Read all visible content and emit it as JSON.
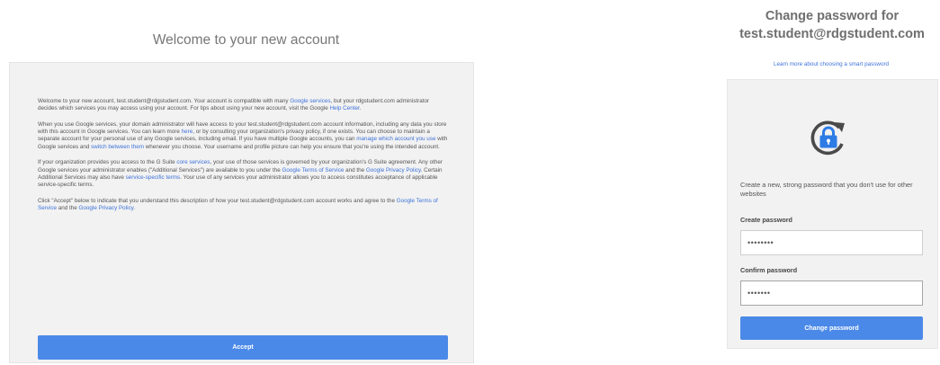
{
  "welcome": {
    "title": "Welcome to your new account",
    "p1": {
      "t1": "Welcome to your new account, test.student@rdgstudent.com. Your account is compatible with many ",
      "l1": "Google services",
      "t2": ", but your rdgstudent.com administrator decides which services you may access using your account. For tips about using your new account, visit the Google ",
      "l2": "Help Center",
      "t3": "."
    },
    "p2": {
      "t1": "When you use Google services, your domain administrator will have access to your test.student@rdgstudent.com account information, including any data you store with this account in Google services. You can learn more ",
      "l1": "here",
      "t2": ", or by consulting your organization's privacy policy, if one exists. You can choose to maintain a separate account for your personal use of any Google services, including email. If you have multiple Google accounts, you can ",
      "l2": "manage which account you use",
      "t3": " with Google services and ",
      "l3": "switch between them",
      "t4": " whenever you choose. Your username and profile picture can help you ensure that you're using the intended account."
    },
    "p3": {
      "t1": "If your organization provides you access to the G Suite ",
      "l1": "core services",
      "t2": ", your use of those services is governed by your organization's G Suite agreement. Any other Google services your administrator enables (\"Additional Services\") are available to you under the ",
      "l2": "Google Terms of Service",
      "t3": " and the ",
      "l3": "Google Privacy Policy",
      "t4": ". Certain Additional Services may also have ",
      "l4": "service-specific terms",
      "t5": ". Your use of any services your administrator allows you to access constitutes acceptance of applicable service-specific terms."
    },
    "p4": {
      "t1": "Click \"Accept\" below to indicate that you understand this description of how your test.student@rdgstudent.com account works and agree to the ",
      "l1": "Google Terms of Service",
      "t2": " and the ",
      "l2": "Google Privacy Policy",
      "t3": "."
    },
    "accept_label": "Accept"
  },
  "change_password": {
    "heading_line1": "Change password for",
    "heading_line2": "test.student@rdgstudent.com",
    "learn_more": "Learn more about choosing a smart password",
    "icon": "lock-refresh-icon",
    "description": "Create a new, strong password that you don't use for other websites",
    "create_label": "Create password",
    "create_value": "••••••••",
    "confirm_label": "Confirm password",
    "confirm_value": "•••••••",
    "button_label": "Change password"
  },
  "colors": {
    "accent": "#4a89e8",
    "link": "#3d72d8",
    "card_bg": "#f2f2f2",
    "icon": "#2d7be5"
  }
}
